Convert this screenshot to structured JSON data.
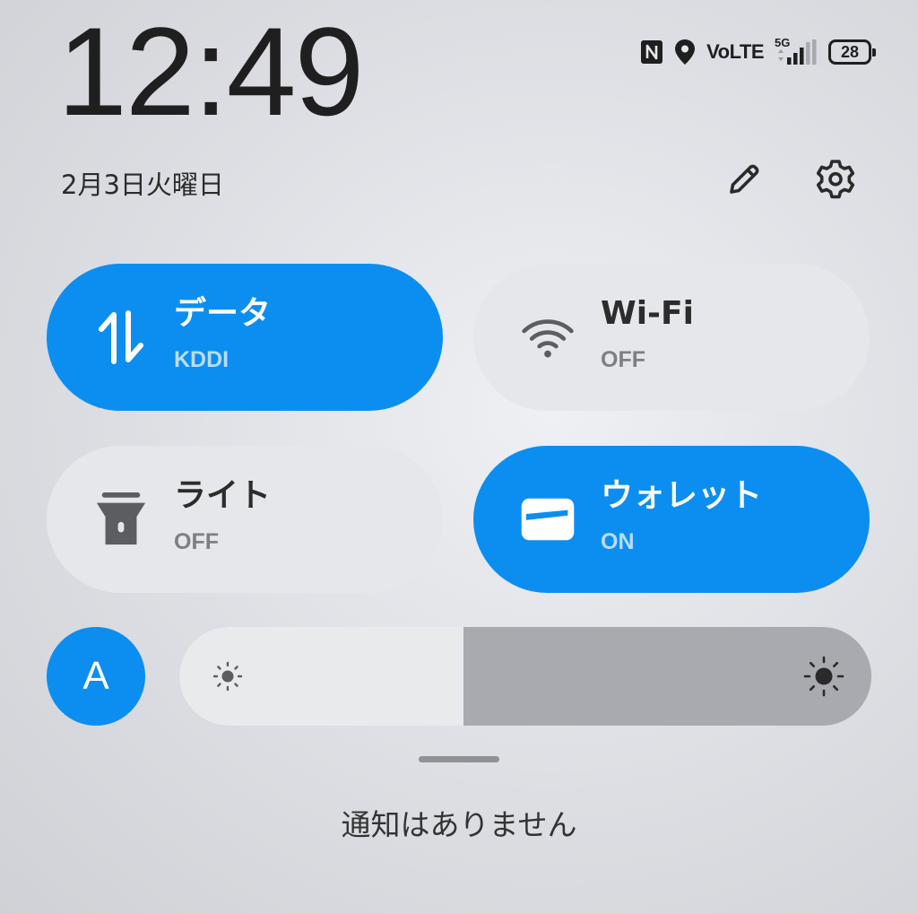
{
  "header": {
    "time": "12:49",
    "date": "2月3日火曜日"
  },
  "status_bar": {
    "network_label": "VoLTE",
    "generation": "5G",
    "battery": "28",
    "icons": [
      "nfc-icon",
      "location-icon",
      "volte-label",
      "signal-5g-icon",
      "battery-icon"
    ]
  },
  "header_actions": {
    "edit_icon": "pencil-icon",
    "settings_icon": "gear-icon"
  },
  "tiles": [
    {
      "title": "データ",
      "subtitle": "KDDI",
      "state": "on",
      "icon": "mobile-data-icon"
    },
    {
      "title": "Wi-Fi",
      "subtitle": "OFF",
      "state": "off",
      "icon": "wifi-icon"
    },
    {
      "title": "ライト",
      "subtitle": "OFF",
      "state": "off",
      "icon": "flashlight-icon"
    },
    {
      "title": "ウォレット",
      "subtitle": "ON",
      "state": "on",
      "icon": "wallet-icon"
    }
  ],
  "brightness": {
    "auto_label": "A",
    "level": 0.41
  },
  "notifications": {
    "empty_text": "通知はありません"
  },
  "colors": {
    "accent": "#0c8ef0",
    "tile_off": "#e6e7ea"
  }
}
